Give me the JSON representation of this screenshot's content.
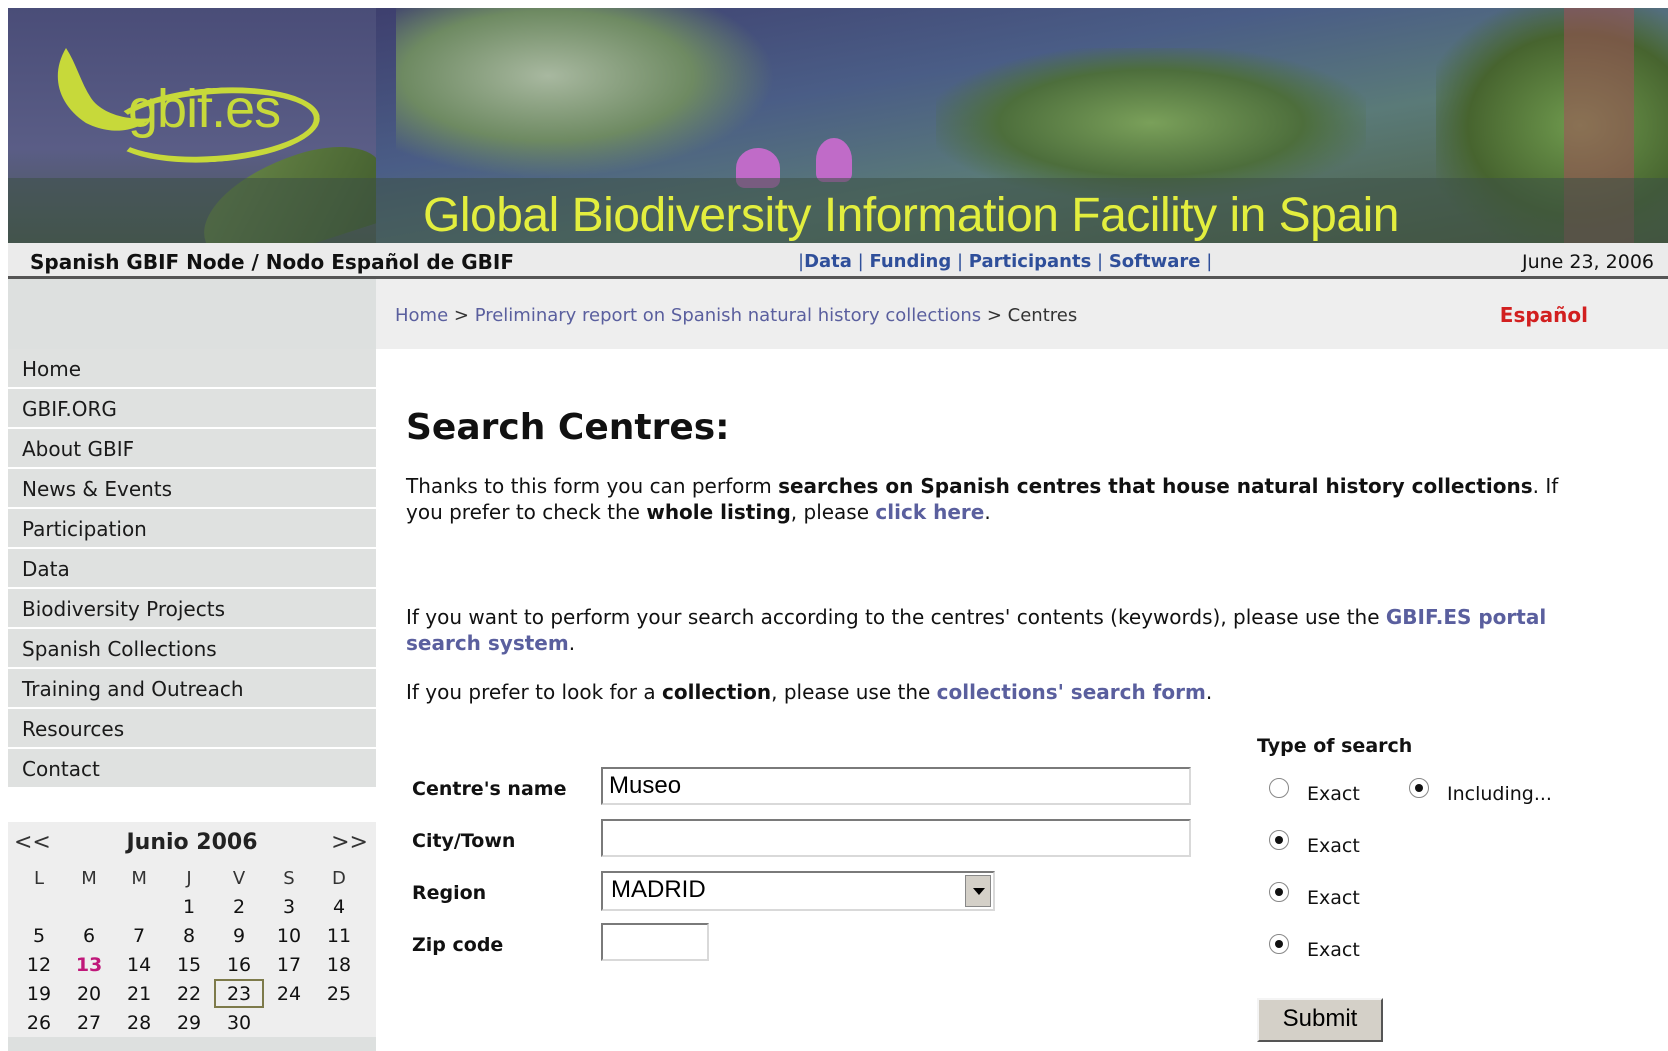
{
  "banner": {
    "logo_text": "gbif.es",
    "title": "Global Biodiversity Information Facility in Spain"
  },
  "topbar": {
    "node_title": "Spanish GBIF Node / Nodo Español de GBIF",
    "links": [
      "Data",
      "Funding",
      "Participants",
      "Software"
    ],
    "date": "June 23, 2006"
  },
  "breadcrumb": {
    "home": "Home",
    "sep1": " > ",
    "report": "Preliminary report on Spanish natural history collections",
    "sep2": " > ",
    "current": "Centres"
  },
  "lang_link": "Español",
  "sidebar": {
    "items": [
      "Home",
      "GBIF.ORG",
      "About GBIF",
      "News & Events",
      "Participation",
      "Data",
      "Biodiversity Projects",
      "Spanish Collections",
      "Training and Outreach",
      "Resources",
      "Contact"
    ]
  },
  "calendar": {
    "prev": "<<",
    "next": ">>",
    "title": "Junio 2006",
    "weekdays": [
      "L",
      "M",
      "M",
      "J",
      "V",
      "S",
      "D"
    ],
    "weeks": [
      [
        "",
        "",
        "",
        "1",
        "2",
        "3",
        "4"
      ],
      [
        "5",
        "6",
        "7",
        "8",
        "9",
        "10",
        "11"
      ],
      [
        "12",
        "13",
        "14",
        "15",
        "16",
        "17",
        "18"
      ],
      [
        "19",
        "20",
        "21",
        "22",
        "23",
        "24",
        "25"
      ],
      [
        "26",
        "27",
        "28",
        "29",
        "30",
        "",
        ""
      ]
    ],
    "highlight_day": "13",
    "today": "23",
    "highlight_color": "#c0187a"
  },
  "main": {
    "heading": "Search Centres:",
    "p1_a": "Thanks to this form you can perform ",
    "p1_b": "searches on Spanish centres that house natural history collections",
    "p1_c": ". If you prefer to check the ",
    "p1_d": "whole listing",
    "p1_e": ", please ",
    "p1_link": "click here",
    "p1_f": ".",
    "p2_a": "If you want to perform your search according to the centres' contents (keywords), please use the ",
    "p2_link": "GBIF.ES portal search system",
    "p2_b": ".",
    "p3_a": "If you prefer to look for a ",
    "p3_b": "collection",
    "p3_c": ", please use the ",
    "p3_link": "collections' search form",
    "p3_d": "."
  },
  "form": {
    "type_title": "Type of search",
    "fields": {
      "name_label": "Centre's name",
      "name_value": "Museo",
      "city_label": "City/Town",
      "city_value": "",
      "region_label": "Region",
      "region_value": "MADRID",
      "zip_label": "Zip code",
      "zip_value": ""
    },
    "radio_exact": "Exact",
    "radio_including": "Including...",
    "submit": "Submit"
  },
  "colors": {
    "link": "#5a5f9e",
    "top_link": "#2f4f9a",
    "lang": "#d21f1f",
    "banner_title": "#e3ee3e",
    "logo": "#c7d93a"
  }
}
